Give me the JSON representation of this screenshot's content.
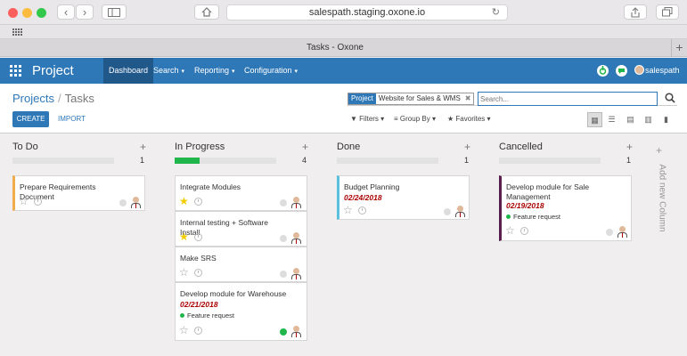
{
  "browser": {
    "url": "salespath.staging.oxone.io",
    "tab_title": "Tasks - Oxone"
  },
  "navbar": {
    "brand": "Project",
    "menus": [
      {
        "label": "Dashboard",
        "active": true
      },
      {
        "label": "Search",
        "active": false
      },
      {
        "label": "Reporting",
        "active": false
      },
      {
        "label": "Configuration",
        "active": false
      }
    ],
    "user": "salespath"
  },
  "control": {
    "breadcrumb_parent": "Projects",
    "breadcrumb_current": "Tasks",
    "create_label": "CREATE",
    "import_label": "IMPORT",
    "facet_label": "Project",
    "facet_value": "Website for Sales & WMS",
    "search_placeholder": "Search...",
    "filters_label": "Filters",
    "groupby_label": "Group By",
    "favorites_label": "Favorites"
  },
  "columns": [
    {
      "title": "To Do",
      "count": "1",
      "progress": 0,
      "cards": [
        {
          "title": "Prepare Requirements Document",
          "date": "",
          "tag": "",
          "starred": false,
          "status": "grey"
        }
      ]
    },
    {
      "title": "In Progress",
      "count": "4",
      "progress": 0.25,
      "cards": [
        {
          "title": "Integrate Modules",
          "date": "",
          "tag": "",
          "starred": true,
          "status": "grey"
        },
        {
          "title": "Internal testing + Software Install",
          "date": "",
          "tag": "",
          "starred": true,
          "status": "grey"
        },
        {
          "title": "Make SRS",
          "date": "",
          "tag": "",
          "starred": false,
          "status": "grey"
        },
        {
          "title": "Develop module for Warehouse",
          "date": "02/21/2018",
          "tag": "Feature request",
          "starred": false,
          "status": "green"
        }
      ]
    },
    {
      "title": "Done",
      "count": "1",
      "progress": 0,
      "cards": [
        {
          "title": "Budget Planning",
          "date": "02/24/2018",
          "tag": "",
          "starred": false,
          "status": "grey"
        }
      ]
    },
    {
      "title": "Cancelled",
      "count": "1",
      "progress": 0,
      "cards": [
        {
          "title": "Develop module for Sale Management",
          "date": "02/19/2018",
          "tag": "Feature request",
          "starred": false,
          "status": "grey"
        }
      ]
    }
  ],
  "add_column_label": "Add new Column",
  "colors": {
    "navbar": "#2f78b7",
    "progress": "#21b64b",
    "date": "#aa0000"
  }
}
